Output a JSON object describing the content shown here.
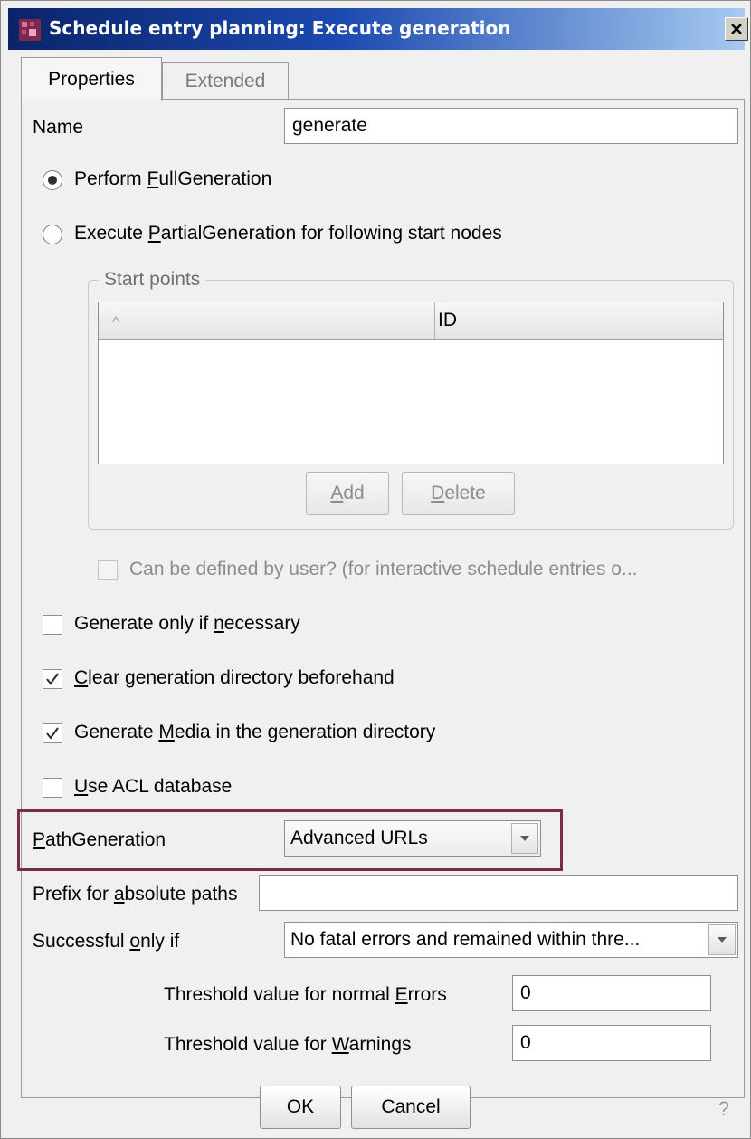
{
  "window": {
    "title": "Schedule entry planning: Execute generation"
  },
  "tabs": [
    {
      "label": "Properties",
      "active": true
    },
    {
      "label": "Extended",
      "active": false
    }
  ],
  "name_field": {
    "label": "Name",
    "value": "generate"
  },
  "generation_mode": {
    "full": {
      "prefix": "Perform ",
      "mnemonic": "F",
      "suffix": "ullGeneration",
      "selected": true
    },
    "partial": {
      "prefix": "Execute ",
      "mnemonic": "P",
      "suffix": "artialGeneration for following start nodes",
      "selected": false
    }
  },
  "start_points": {
    "title": "Start points",
    "columns": [
      "",
      "ID"
    ],
    "rows": [],
    "add_button": {
      "mnemonic": "A",
      "rest": "dd"
    },
    "delete_button": {
      "mnemonic": "D",
      "rest": "elete"
    }
  },
  "user_defined": {
    "label": "Can be defined by user? (for interactive schedule entries o...",
    "checked": false,
    "enabled": false
  },
  "options": {
    "necessary": {
      "prefix": "Generate only if ",
      "mnemonic": "n",
      "suffix": "ecessary",
      "checked": false
    },
    "clear_dir": {
      "prefix": "",
      "mnemonic": "C",
      "suffix": "lear generation directory beforehand",
      "checked": true
    },
    "media": {
      "prefix": "Generate ",
      "mnemonic": "M",
      "suffix": "edia in the generation directory",
      "checked": true
    },
    "acl": {
      "prefix": "",
      "mnemonic": "U",
      "suffix": "se ACL database",
      "checked": false
    }
  },
  "path_generation": {
    "mnemonic": "P",
    "rest": "athGeneration",
    "value": "Advanced URLs"
  },
  "prefix_paths": {
    "prefix": "Prefix for ",
    "mnemonic": "a",
    "suffix": "bsolute paths",
    "value": ""
  },
  "successful_only_if": {
    "prefix": "Successful ",
    "mnemonic": "o",
    "suffix": "nly if",
    "value": "No fatal errors and remained within thre..."
  },
  "threshold_errors": {
    "prefix": "Threshold value for normal ",
    "mnemonic": "E",
    "suffix": "rrors",
    "value": "0"
  },
  "threshold_warnings": {
    "prefix": "Threshold value for ",
    "mnemonic": "W",
    "suffix": "arnings",
    "value": "0"
  },
  "footer": {
    "ok": "OK",
    "cancel": "Cancel",
    "help": "?"
  },
  "colors": {
    "title_gradient_start": "#0a246a",
    "title_gradient_end": "#a6caf0",
    "highlight_border": "#7a2a4c"
  }
}
